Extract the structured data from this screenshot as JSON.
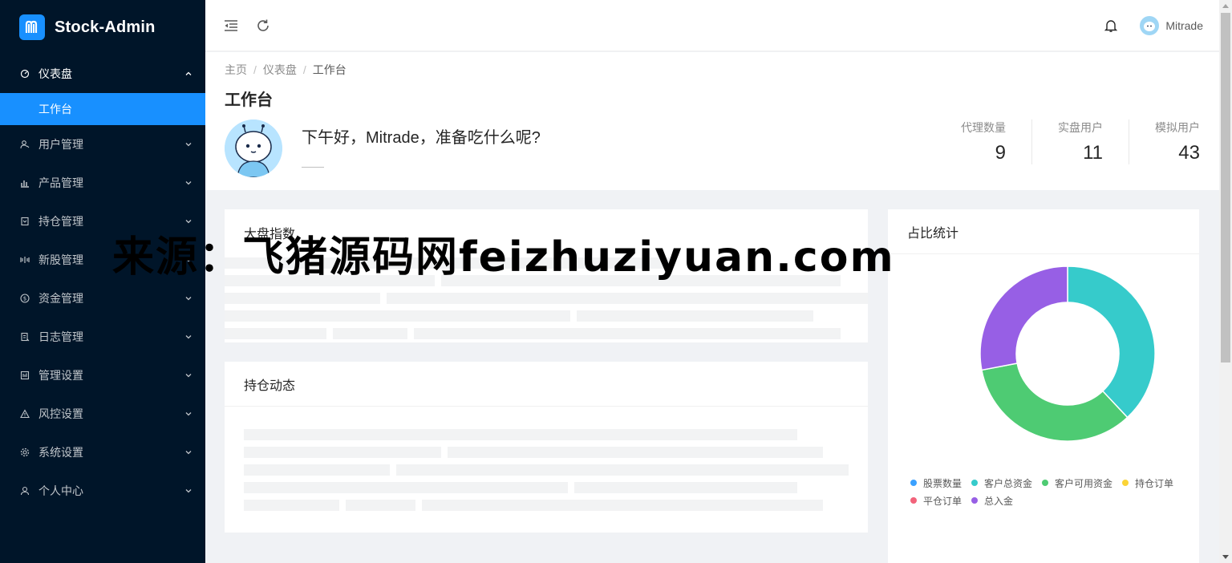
{
  "app": {
    "title": "Stock-Admin"
  },
  "sidebar": {
    "items": [
      {
        "label": "仪表盘",
        "icon": "dashboard-icon",
        "open": true
      },
      {
        "label": "工作台",
        "sub": true,
        "selected": true
      },
      {
        "label": "用户管理",
        "icon": "user-manage-icon"
      },
      {
        "label": "产品管理",
        "icon": "product-chart-icon"
      },
      {
        "label": "持仓管理",
        "icon": "position-icon"
      },
      {
        "label": "新股管理",
        "icon": "new-stock-icon"
      },
      {
        "label": "资金管理",
        "icon": "dollar-icon"
      },
      {
        "label": "日志管理",
        "icon": "log-icon"
      },
      {
        "label": "管理设置",
        "icon": "admin-settings-icon"
      },
      {
        "label": "风控设置",
        "icon": "warning-icon"
      },
      {
        "label": "系统设置",
        "icon": "gear-icon"
      },
      {
        "label": "个人中心",
        "icon": "person-icon"
      }
    ]
  },
  "topbar": {
    "username": "Mitrade"
  },
  "breadcrumb": [
    "主页",
    "仪表盘",
    "工作台"
  ],
  "page": {
    "title": "工作台",
    "greeting": "下午好，Mitrade，准备吃什么呢?"
  },
  "stats": [
    {
      "label": "代理数量",
      "value": "9"
    },
    {
      "label": "实盘用户",
      "value": "11"
    },
    {
      "label": "模拟用户",
      "value": "43"
    }
  ],
  "cards": {
    "market": "大盘指数",
    "positions": "持仓动态",
    "ratio": "占比统计"
  },
  "chart_data": {
    "type": "pie",
    "labels": [
      "股票数量",
      "客户总资金",
      "客户可用资金",
      "持仓订单",
      "平仓订单",
      "总入金"
    ],
    "values": [
      0,
      38,
      34,
      0,
      0,
      28
    ],
    "colors": [
      "#3ba1ff",
      "#36cbcb",
      "#4ecb73",
      "#fbd437",
      "#f2637b",
      "#975fe5"
    ],
    "legend": "bottom"
  },
  "watermark": "来源：飞猪源码网feizhuziyuan.com"
}
